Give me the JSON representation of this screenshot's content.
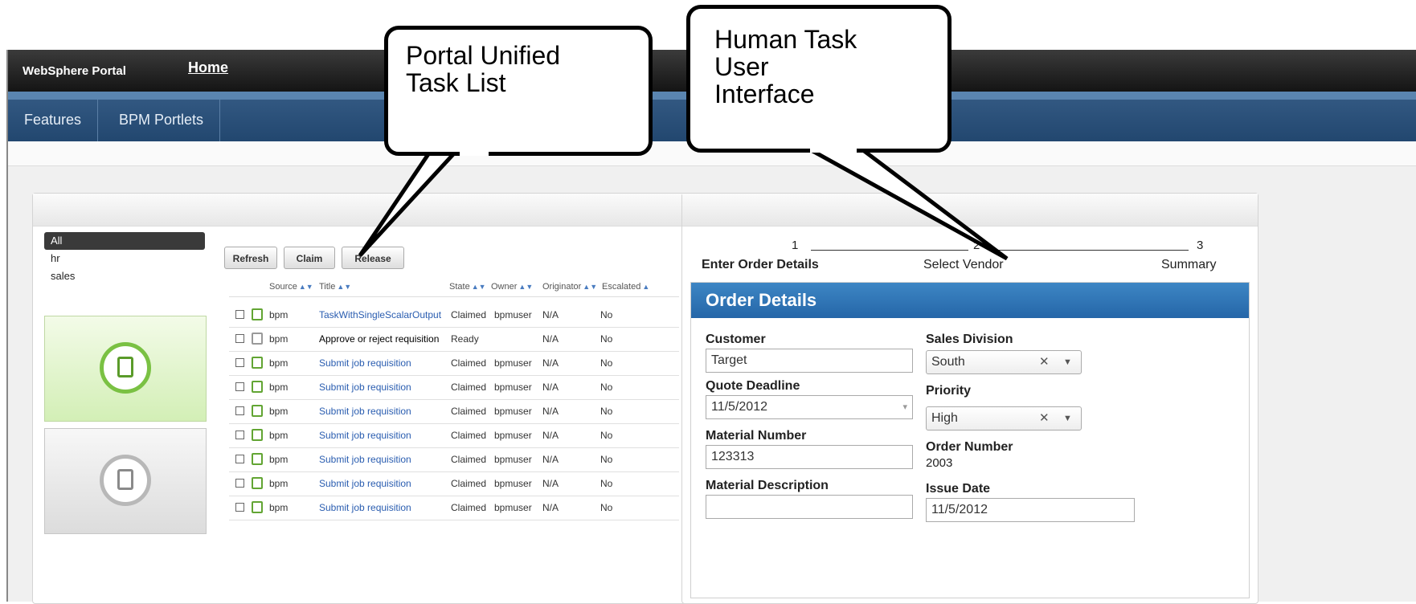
{
  "portal": {
    "brand": "WebSphere Portal",
    "home": "Home",
    "nav": [
      "Features",
      "BPM Portlets"
    ]
  },
  "task_list": {
    "menu_icon": "▾≡",
    "filters": [
      {
        "label": "All",
        "selected": true
      },
      {
        "label": "hr",
        "selected": false
      },
      {
        "label": "sales",
        "selected": false
      }
    ],
    "buttons": [
      "Refresh",
      "Claim",
      "Release"
    ],
    "headers": [
      "Source",
      "Title",
      "State",
      "Owner",
      "Originator",
      "Escalated"
    ],
    "rows": [
      {
        "source": "bpm",
        "title": "TaskWithSingleScalarOutput",
        "state": "Claimed",
        "owner": "bpmuser",
        "originator": "N/A",
        "escalated": "No",
        "link": true
      },
      {
        "source": "bpm",
        "title": "Approve or reject requisition",
        "state": "Ready",
        "owner": "",
        "originator": "N/A",
        "escalated": "No",
        "link": false
      },
      {
        "source": "bpm",
        "title": "Submit job requisition",
        "state": "Claimed",
        "owner": "bpmuser",
        "originator": "N/A",
        "escalated": "No",
        "link": true
      },
      {
        "source": "bpm",
        "title": "Submit job requisition",
        "state": "Claimed",
        "owner": "bpmuser",
        "originator": "N/A",
        "escalated": "No",
        "link": true
      },
      {
        "source": "bpm",
        "title": "Submit job requisition",
        "state": "Claimed",
        "owner": "bpmuser",
        "originator": "N/A",
        "escalated": "No",
        "link": true
      },
      {
        "source": "bpm",
        "title": "Submit job requisition",
        "state": "Claimed",
        "owner": "bpmuser",
        "originator": "N/A",
        "escalated": "No",
        "link": true
      },
      {
        "source": "bpm",
        "title": "Submit job requisition",
        "state": "Claimed",
        "owner": "bpmuser",
        "originator": "N/A",
        "escalated": "No",
        "link": true
      },
      {
        "source": "bpm",
        "title": "Submit job requisition",
        "state": "Claimed",
        "owner": "bpmuser",
        "originator": "N/A",
        "escalated": "No",
        "link": true
      },
      {
        "source": "bpm",
        "title": "Submit job requisition",
        "state": "Claimed",
        "owner": "bpmuser",
        "originator": "N/A",
        "escalated": "No",
        "link": true
      }
    ]
  },
  "wizard": {
    "steps": [
      {
        "num": "1",
        "label": "Enter Order Details",
        "active": true
      },
      {
        "num": "2",
        "label": "Select Vendor",
        "active": false
      },
      {
        "num": "3",
        "label": "Summary",
        "active": false
      }
    ]
  },
  "order": {
    "title": "Order Details",
    "customer_label": "Customer",
    "customer_value": "Target",
    "deadline_label": "Quote Deadline",
    "deadline_value": "11/5/2012",
    "material_number_label": "Material Number",
    "material_number_value": "123313",
    "material_desc_label": "Material Description",
    "material_desc_value": "",
    "sales_division_label": "Sales Division",
    "sales_division_value": "South",
    "priority_label": "Priority",
    "priority_value": "High",
    "order_number_label": "Order Number",
    "order_number_value": "2003",
    "issue_date_label": "Issue Date",
    "issue_date_value": "11/5/2012"
  },
  "callouts": {
    "task_list": [
      "Portal Unified",
      "Task List"
    ],
    "human_task": [
      "Human Task",
      "User",
      "Interface"
    ]
  },
  "colors": {
    "topbar": "#1e1e1e",
    "navbar": "#2b5078",
    "order_header": "#2f76b8",
    "link": "#2a5db0",
    "tile_green": "#7ac143"
  }
}
